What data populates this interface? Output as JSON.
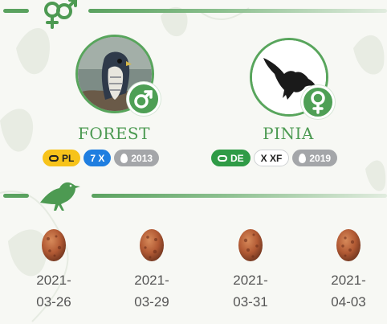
{
  "colors": {
    "accent": "#5aa25f",
    "badge_green": "#4e9f55"
  },
  "sections": {
    "pair": {
      "icon": "mars-venus-icon"
    },
    "eggs": {
      "icon": "bird-icon"
    }
  },
  "birds": [
    {
      "name": "FOREST",
      "sex": "male",
      "sex_icon": "mars-icon",
      "photo": "peregrine-falcon-photo",
      "badges": [
        {
          "type": "ring",
          "icon": "ring-icon",
          "text": "PL",
          "style": "yellow"
        },
        {
          "type": "ring-code",
          "text": "7 X",
          "style": "blue"
        },
        {
          "type": "year",
          "icon": "egg-icon",
          "text": "2013",
          "style": "gray"
        }
      ]
    },
    {
      "name": "PINIA",
      "sex": "female",
      "sex_icon": "venus-icon",
      "photo": "bird-silhouette",
      "badges": [
        {
          "type": "ring",
          "icon": "ring-icon",
          "text": "DE",
          "style": "green"
        },
        {
          "type": "ring-code",
          "text": "X XF",
          "style": "white"
        },
        {
          "type": "year",
          "icon": "egg-icon",
          "text": "2019",
          "style": "gray"
        }
      ]
    }
  ],
  "eggs": [
    {
      "date_line1": "2021-",
      "date_line2": "03-26"
    },
    {
      "date_line1": "2021-",
      "date_line2": "03-29"
    },
    {
      "date_line1": "2021-",
      "date_line2": "03-31"
    },
    {
      "date_line1": "2021-",
      "date_line2": "04-03"
    }
  ]
}
